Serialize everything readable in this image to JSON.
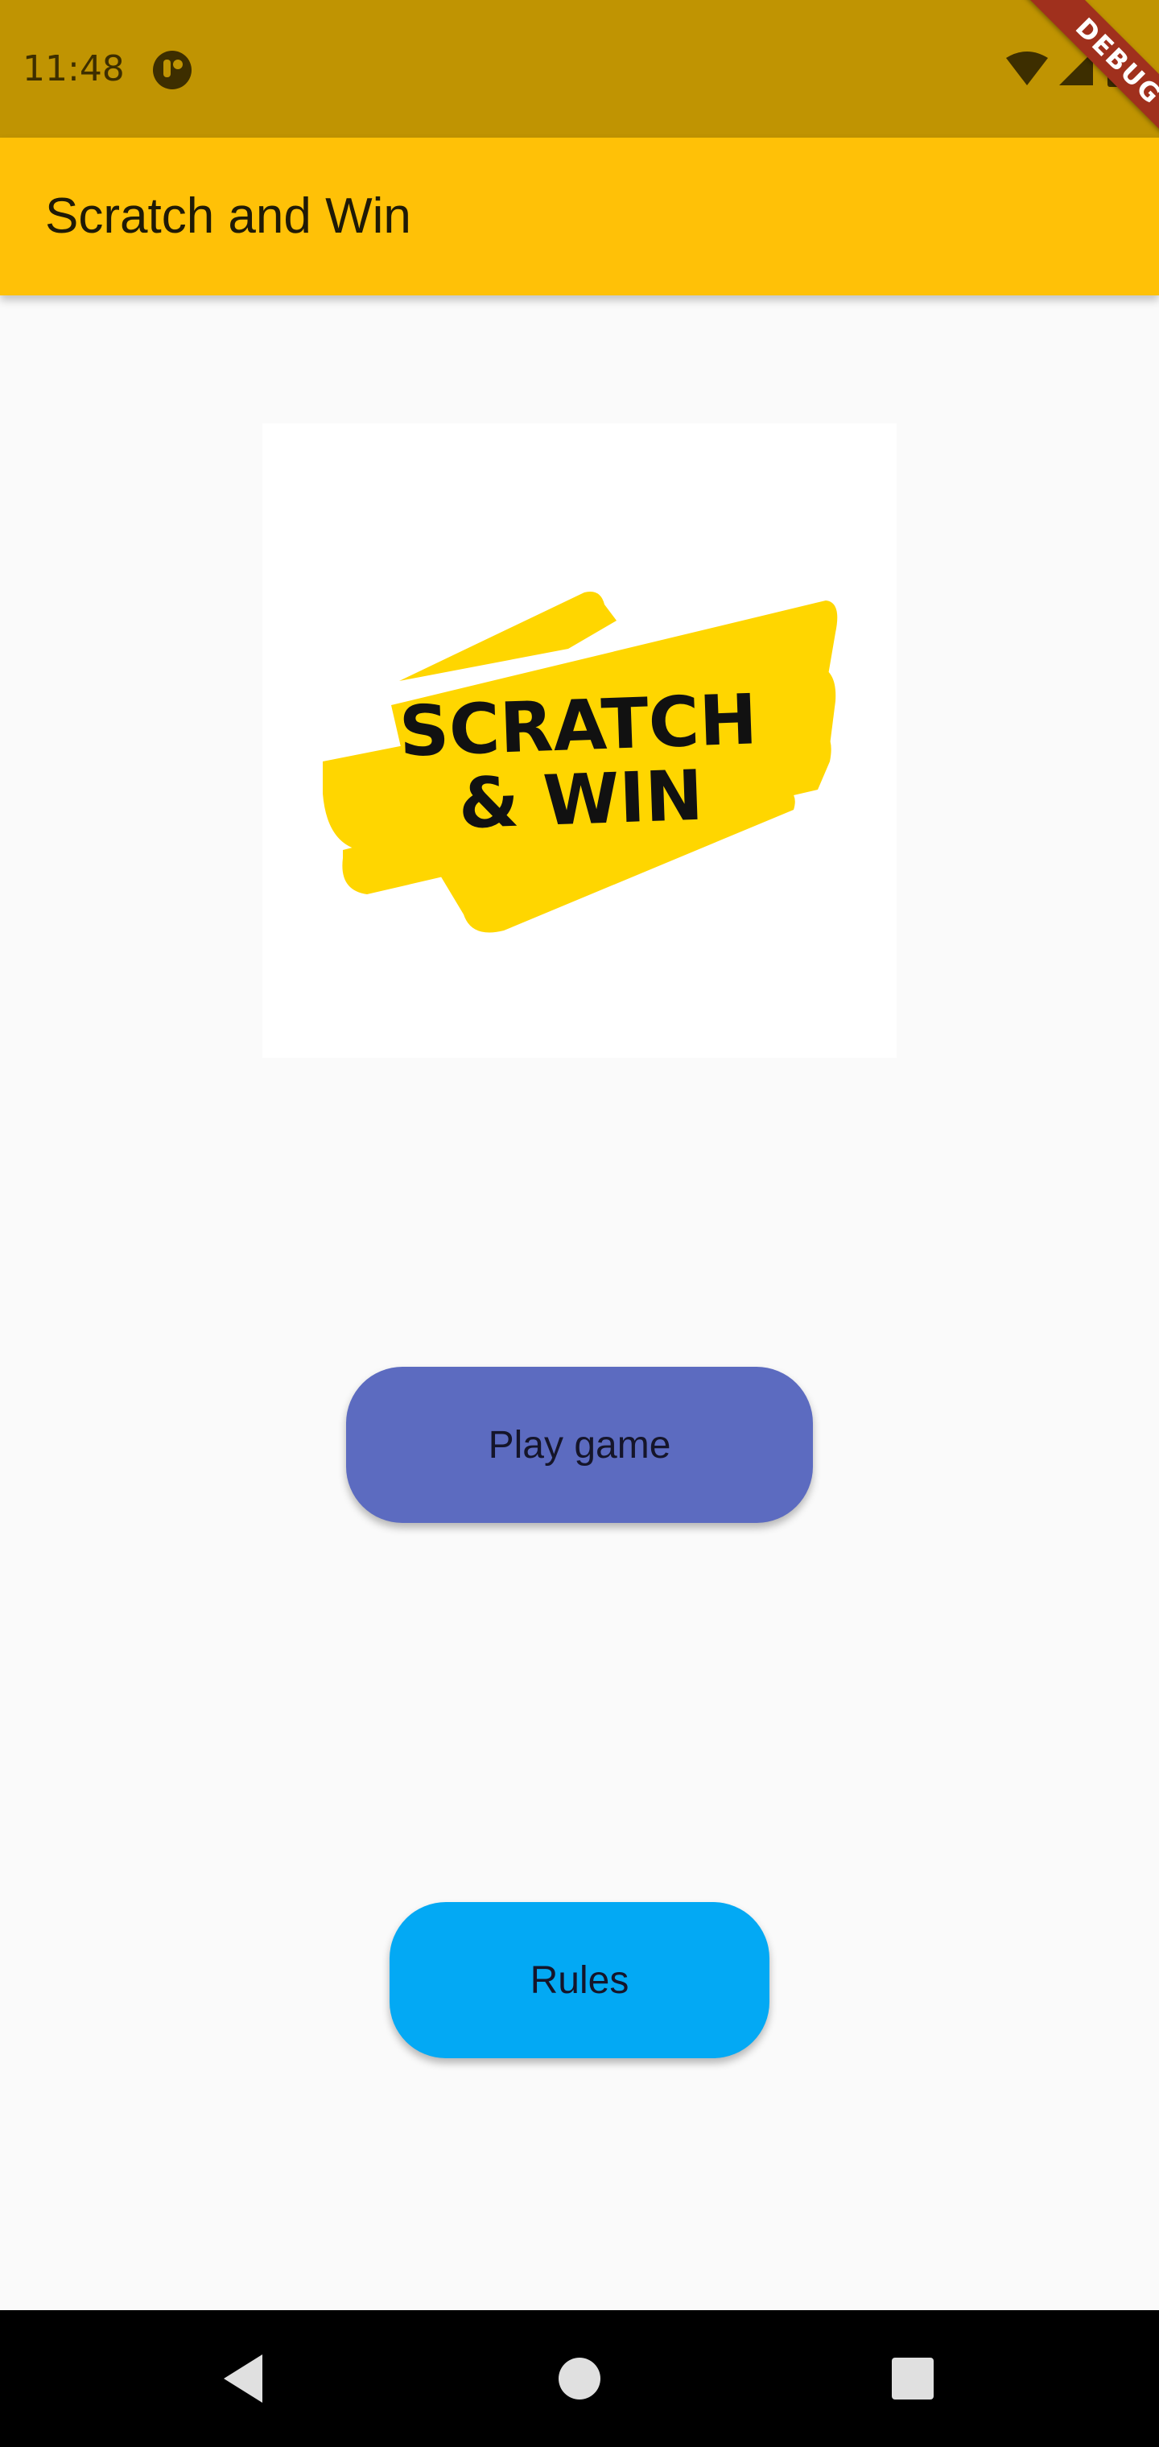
{
  "status_bar": {
    "time": "11:48",
    "app_icon": "notification-app-icon",
    "icons": [
      "wifi-icon",
      "cell-signal-icon",
      "battery-icon"
    ]
  },
  "debug_banner": {
    "label": "DEBUG"
  },
  "app_bar": {
    "title": "Scratch and Win"
  },
  "logo": {
    "line1": "SCRATCH",
    "line2": "& WIN",
    "brush_color": "#ffd600",
    "text_color": "#111111"
  },
  "buttons": {
    "play_label": "Play game",
    "play_color": "#5c6bc0",
    "rules_label": "Rules",
    "rules_color": "#03a9f4"
  },
  "nav_bar": {
    "icons": [
      "back-icon",
      "home-icon",
      "recents-icon"
    ]
  },
  "colors": {
    "status_bar": "#c09402",
    "app_bar": "#ffc107",
    "background": "#fafafa"
  }
}
